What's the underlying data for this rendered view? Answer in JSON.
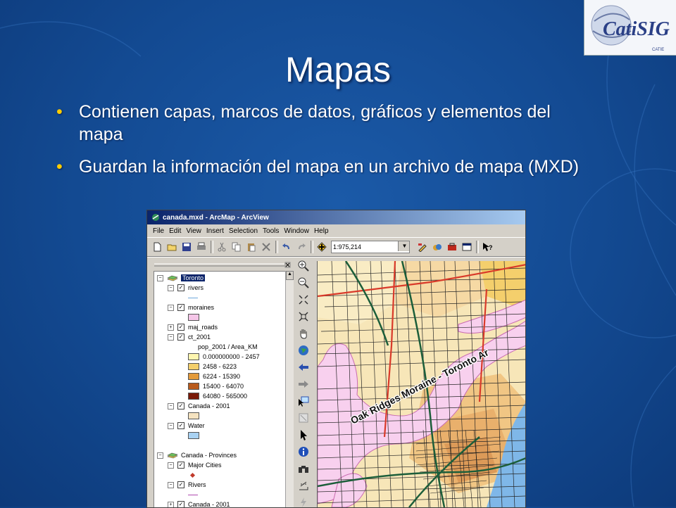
{
  "slide": {
    "title": "Mapas",
    "bullets": [
      "Contienen capas, marcos de datos, gráficos y elementos del mapa",
      "Guardan la información del mapa en un archivo de mapa (MXD)"
    ],
    "bullet_glyph": "•",
    "logo_text": "CatiSIG",
    "logo_sub": "CATIE"
  },
  "window": {
    "title": "canada.mxd - ArcMap - ArcView",
    "menu": [
      "File",
      "Edit",
      "View",
      "Insert",
      "Selection",
      "Tools",
      "Window",
      "Help"
    ],
    "scale": "1:975,214",
    "toolbar_icons": [
      "new-icon",
      "open-icon",
      "save-icon",
      "print-icon",
      "cut-icon",
      "copy-icon",
      "paste-icon",
      "delete-icon",
      "undo-icon",
      "redo-icon",
      "add-data-icon",
      "editor-icon",
      "layer-icon",
      "toolbox-icon",
      "window-icon",
      "help-icon"
    ],
    "tools": [
      "zoom-in-icon",
      "zoom-out-icon",
      "fixed-zoom-in-icon",
      "fixed-zoom-out-icon",
      "pan-icon",
      "full-extent-icon",
      "back-icon",
      "forward-icon",
      "select-features-icon",
      "clear-selection-icon",
      "select-elements-icon",
      "identify-icon",
      "find-icon",
      "measure-icon",
      "hyperlink-icon"
    ]
  },
  "toc": {
    "rows": [
      {
        "type": "frame",
        "label": "Toronto",
        "expanded": true,
        "selected": true
      },
      {
        "type": "layer",
        "label": "rivers",
        "checked": true
      },
      {
        "type": "symbol-line",
        "label": "",
        "color": "#6fa8dc"
      },
      {
        "type": "layer",
        "label": "moraines",
        "checked": true
      },
      {
        "type": "symbol",
        "label": "",
        "color": "#f5c6e8"
      },
      {
        "type": "layer",
        "label": "maj_roads",
        "checked": true,
        "collapsed": true
      },
      {
        "type": "layer",
        "label": "ct_2001",
        "checked": true
      },
      {
        "type": "field",
        "label": "pop_2001 / Area_KM"
      },
      {
        "type": "class",
        "label": "0.000000000 - 2457",
        "color": "#fff6b0"
      },
      {
        "type": "class",
        "label": "2458 - 6223",
        "color": "#f4cf6c"
      },
      {
        "type": "class",
        "label": "6224 - 15390",
        "color": "#e39a3b"
      },
      {
        "type": "class",
        "label": "15400 - 64070",
        "color": "#b85a1c"
      },
      {
        "type": "class",
        "label": "64080 - 565000",
        "color": "#7a1a08"
      },
      {
        "type": "layer",
        "label": "Canada - 2001",
        "checked": true
      },
      {
        "type": "symbol",
        "label": "",
        "color": "#f5e3c0"
      },
      {
        "type": "layer",
        "label": "Water",
        "checked": true
      },
      {
        "type": "symbol",
        "label": "",
        "color": "#a9d2f2"
      },
      {
        "type": "blank",
        "label": ""
      },
      {
        "type": "frame",
        "label": "Canada - Provinces",
        "expanded": true,
        "selected": false
      },
      {
        "type": "layer",
        "label": "Major Cities",
        "checked": true
      },
      {
        "type": "symbol-dot",
        "label": "",
        "color": "#c0392b"
      },
      {
        "type": "layer",
        "label": "Rivers",
        "checked": true
      },
      {
        "type": "symbol-line",
        "label": "",
        "color": "#b04ab0"
      },
      {
        "type": "layer",
        "label": "Canada - 2001",
        "checked": true,
        "collapsed": true
      }
    ]
  },
  "map": {
    "label": "Oak Ridges Moraine - Toronto Ar",
    "colors": {
      "base": "#f7e6b8",
      "moraine": "#f8d0ee",
      "water": "#7fb7e8",
      "roads": "#1a1a1a",
      "highway": "#1c5e3a",
      "boundary": "#d93a2a"
    }
  }
}
